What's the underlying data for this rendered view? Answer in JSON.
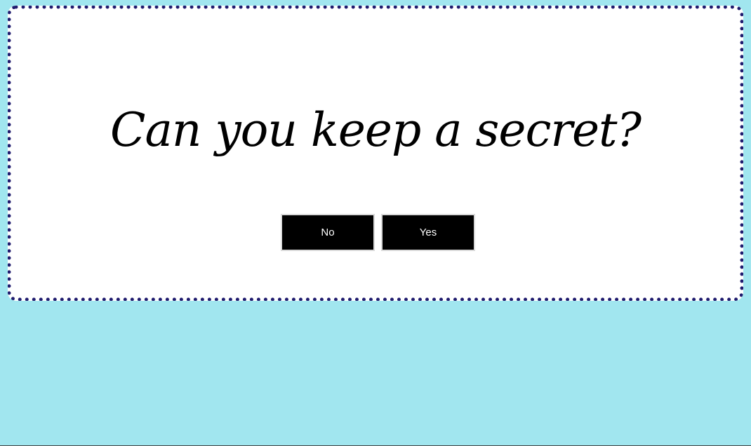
{
  "dialog": {
    "question": "Can you keep a secret?",
    "buttons": {
      "no_label": "No",
      "yes_label": "Yes"
    }
  },
  "colors": {
    "page_background": "#a1e6ef",
    "card_background": "#ffffff",
    "dotted_border": "#1f1b6e",
    "button_background": "#000000",
    "button_text": "#ffffff"
  }
}
